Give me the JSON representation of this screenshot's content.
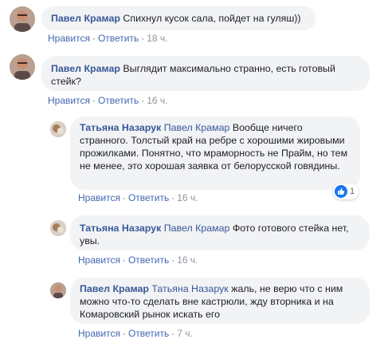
{
  "comments": [
    {
      "author": "Павел Крамар",
      "mention": "",
      "text": "Спихнул кусок сала, пойдет на гуляш))",
      "like": "Нравится",
      "reply": "Ответить",
      "time": "18 ч."
    },
    {
      "author": "Павел Крамар",
      "mention": "",
      "text": "Выглядит максимально странно, есть готовый стейк?",
      "like": "Нравится",
      "reply": "Ответить",
      "time": "16 ч."
    },
    {
      "author": "Татьяна Назарук",
      "mention": "Павел Крамар",
      "text": "Вообще ничего странного. Толстый край на ребре с хорошими жировыми прожилками. Понятно, что мраморность не Прайм, но тем не менее, это хорошая заявка от белорусской говядины.",
      "like": "Нравится",
      "reply": "Ответить",
      "time": "16 ч.",
      "reaction_count": "1"
    },
    {
      "author": "Татьяна Назарук",
      "mention": "Павел Крамар",
      "text": "Фото готового стейка нет, увы.",
      "like": "Нравится",
      "reply": "Ответить",
      "time": "16 ч."
    },
    {
      "author": "Павел Крамар",
      "mention": "Татьяна Назарук",
      "text": "жаль, не верю что с ним можно что-то сделать вне кастрюли, жду вторника и на Комаровский рынок искать его",
      "like": "Нравится",
      "reply": "Ответить",
      "time": "7 ч."
    }
  ],
  "separator": "·",
  "colors": {
    "link": "#385898",
    "action": "#4267b2",
    "bubble": "#f2f3f5",
    "like": "#1877f2"
  }
}
